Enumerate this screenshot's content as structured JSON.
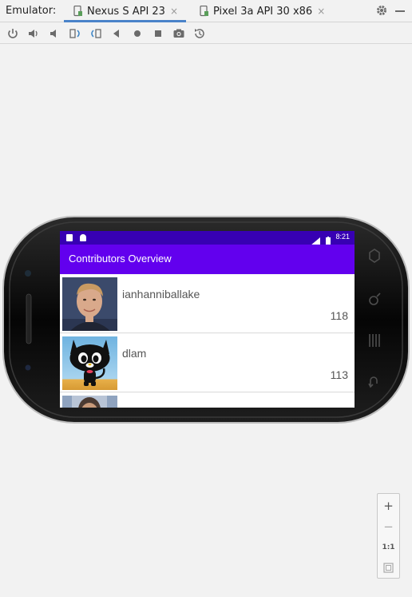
{
  "tabbar": {
    "label": "Emulator:",
    "tabs": [
      {
        "label": "Nexus S API 23",
        "close": "×"
      },
      {
        "label": "Pixel 3a API 30 x86",
        "close": "×"
      }
    ]
  },
  "toolbar": {
    "icons": [
      "power-icon",
      "volume-up-icon",
      "volume-down-icon",
      "rotate-left-icon",
      "rotate-right-icon",
      "back-icon",
      "home-icon",
      "overview-icon",
      "screenshot-icon",
      "snapshot-icon"
    ]
  },
  "device": {
    "status_time": "8:21",
    "app_title": "Contributors Overview",
    "contributors": [
      {
        "name": "ianhanniballake",
        "count": "118"
      },
      {
        "name": "dlam",
        "count": "113"
      },
      {
        "name": "",
        "count": ""
      }
    ]
  },
  "zoom": {
    "plus": "+",
    "minus": "−",
    "one_to_one": "1:1"
  },
  "colors": {
    "status_bar": "#3700b3",
    "app_bar": "#6200ee",
    "tab_underline": "#4a83c9"
  }
}
